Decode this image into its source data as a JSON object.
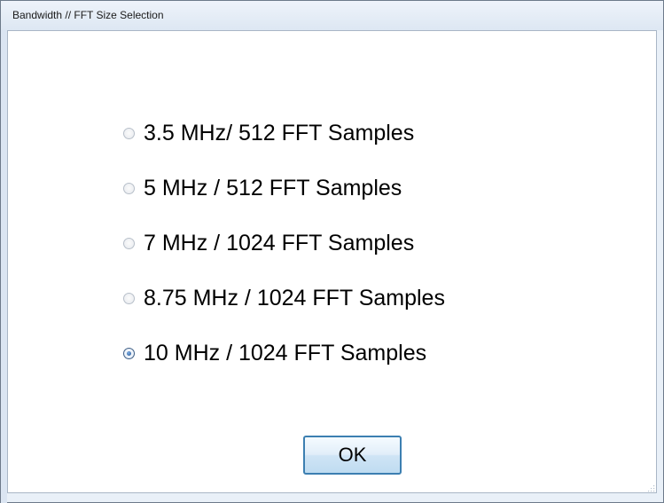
{
  "window": {
    "title": "Bandwidth // FFT Size Selection"
  },
  "options": [
    {
      "label": "3.5 MHz/ 512 FFT Samples",
      "selected": false
    },
    {
      "label": "5 MHz / 512 FFT Samples",
      "selected": false
    },
    {
      "label": "7 MHz / 1024 FFT Samples",
      "selected": false
    },
    {
      "label": "8.75 MHz / 1024 FFT Samples",
      "selected": false
    },
    {
      "label": "10 MHz / 1024 FFT Samples",
      "selected": true
    }
  ],
  "buttons": {
    "ok_label": "OK"
  },
  "icons": {
    "resize": "resize-grip-icon"
  },
  "colors": {
    "accent": "#3c7fb1",
    "selected_dot": "#1f4f8c"
  }
}
